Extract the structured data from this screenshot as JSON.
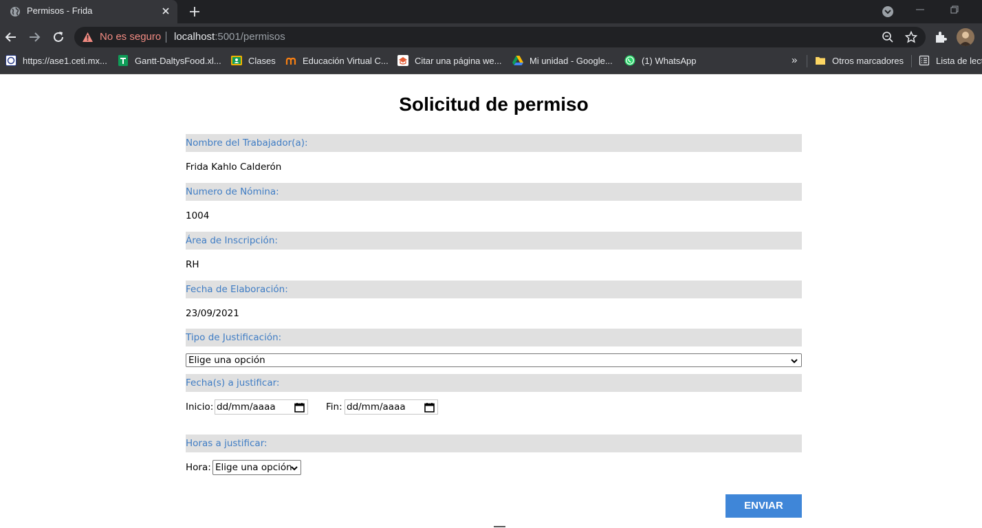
{
  "browser": {
    "tab": {
      "title": "Permisos - Frida"
    },
    "address": {
      "security_label": "No es seguro",
      "host": "localhost",
      "path": ":5001/permisos"
    },
    "bookmarks": [
      {
        "label": "https://ase1.ceti.mx...",
        "icon": "ceti-icon"
      },
      {
        "label": "Gantt-DaltysFood.xl...",
        "icon": "sheets-icon"
      },
      {
        "label": "Clases",
        "icon": "classroom-icon"
      },
      {
        "label": "Educación Virtual C...",
        "icon": "moodle-icon"
      },
      {
        "label": "Citar una página we...",
        "icon": "scribbr-icon"
      },
      {
        "label": "Mi unidad - Google...",
        "icon": "drive-icon"
      },
      {
        "label": "(1) WhatsApp",
        "icon": "whatsapp-icon"
      }
    ],
    "bookmarks_overflow": "»",
    "other_bookmarks": "Otros marcadores",
    "reading_list": "Lista de lect"
  },
  "form": {
    "title": "Solicitud de permiso",
    "worker_name": {
      "label": "Nombre del Trabajador(a):",
      "value": "Frida Kahlo Calderón"
    },
    "payroll_number": {
      "label": "Numero de Nómina:",
      "value": "1004"
    },
    "area": {
      "label": "Área de Inscripción:",
      "value": "RH"
    },
    "date_created": {
      "label": "Fecha de Elaboración:",
      "value": "23/09/2021"
    },
    "justification_type": {
      "label": "Tipo de Justificación:",
      "selected": "Elige una opción"
    },
    "dates_to_justify": {
      "label": "Fecha(s) a justificar:",
      "start_label": "Inicio:",
      "start_value": "dd/mm/aaaa",
      "end_label": "Fin:",
      "end_value": "dd/mm/aaaa"
    },
    "hours_to_justify": {
      "label": "Horas a justificar:",
      "hour_label": "Hora:",
      "selected": "Elige una opción"
    },
    "submit_label": "ENVIAR"
  },
  "colors": {
    "label_bg": "#e0e0e0",
    "label_text": "#3e7cc4",
    "button_bg": "#3f86d8",
    "chrome_dark": "#202124",
    "chrome_mid": "#35363a",
    "insecure": "#f28b82"
  }
}
